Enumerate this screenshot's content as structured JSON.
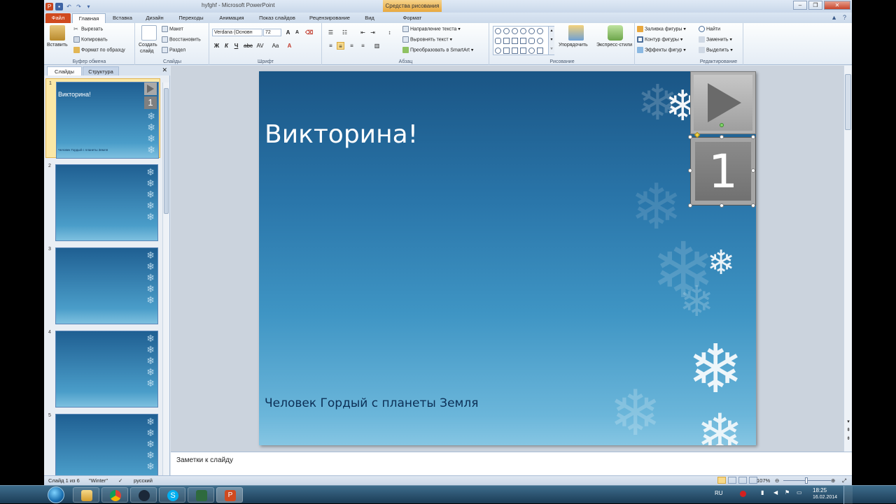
{
  "app": {
    "window_title": "hyfghf  -  Microsoft PowerPoint",
    "context_group": "Средства рисования",
    "context_tab": "Формат"
  },
  "tabs": [
    "Файл",
    "Главная",
    "Вставка",
    "Дизайн",
    "Переходы",
    "Анимация",
    "Показ слайдов",
    "Рецензирование",
    "Вид"
  ],
  "ribbon": {
    "clipboard": {
      "paste": "Вставить",
      "cut": "Вырезать",
      "copy": "Копировать",
      "format_painter": "Формат по образцу",
      "label": "Буфер обмена"
    },
    "slides": {
      "new_slide_1": "Создать",
      "new_slide_2": "слайд",
      "layout": "Макет",
      "reset": "Восстановить",
      "section": "Раздел",
      "label": "Слайды"
    },
    "font": {
      "font_name": "Verdana (Основн",
      "font_size": "72",
      "label": "Шрифт",
      "bold": "Ж",
      "italic": "К",
      "underline": "Ч"
    },
    "paragraph": {
      "text_direction": "Направление текста",
      "align_text": "Выровнять текст",
      "smartart": "Преобразовать в SmartArt",
      "label": "Абзац"
    },
    "drawing": {
      "arrange": "Упорядочить",
      "quick_styles": "Экспресс-стили",
      "fill": "Заливка фигуры",
      "outline": "Контур фигуры",
      "effects": "Эффекты фигур",
      "label": "Рисование"
    },
    "editing": {
      "find": "Найти",
      "replace": "Заменить",
      "select": "Выделить",
      "label": "Редактирование"
    }
  },
  "left_pane": {
    "tab_slides": "Слайды",
    "tab_outline": "Структура",
    "thumbnails": [
      {
        "num": "1",
        "title": "Викторина!",
        "subtitle": "Человек Гордый с планеты Земля",
        "badge": "1"
      },
      {
        "num": "2"
      },
      {
        "num": "3"
      },
      {
        "num": "4"
      },
      {
        "num": "5"
      }
    ]
  },
  "slide": {
    "title": "Викторина!",
    "subtitle": "Человек Гордый с планеты Земля",
    "number_button": "1"
  },
  "notes": {
    "placeholder": "Заметки к слайду"
  },
  "status": {
    "slide_count": "Слайд 1 из 6",
    "theme": "\"Winter\"",
    "language": "русский",
    "zoom": "107%"
  },
  "tray": {
    "lang": "RU",
    "time": "18:25",
    "date": "16.02.2014"
  },
  "colors": {
    "accent": "#d04a1f",
    "slide_top": "#1a5585",
    "slide_bottom": "#86c6e3"
  }
}
